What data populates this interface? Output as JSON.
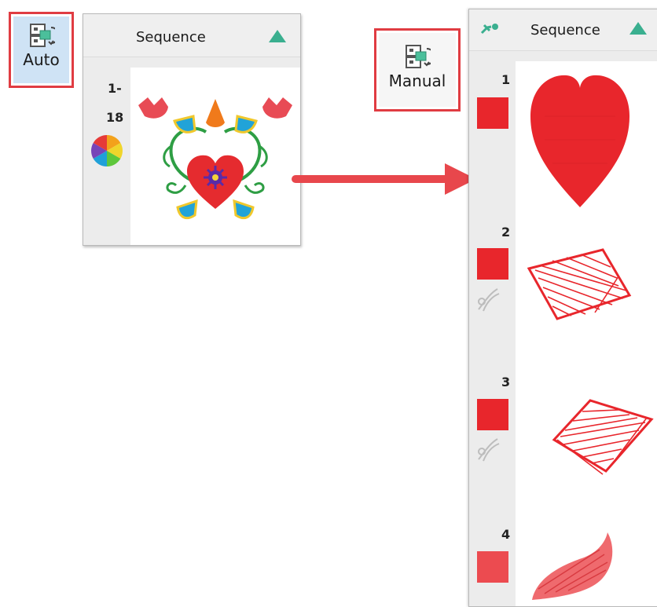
{
  "auto_button": {
    "label": "Auto",
    "icon": "auto-sequence-icon",
    "active": true
  },
  "manual_button": {
    "label": "Manual",
    "icon": "manual-sequence-icon"
  },
  "small_panel": {
    "title": "Sequence",
    "range_start": "1-",
    "range_end": "18",
    "icons": [
      "color-wheel-icon",
      "folk-heart-design-thumbnail"
    ]
  },
  "big_panel": {
    "title": "Sequence",
    "items": [
      {
        "number": "1",
        "color": "#e8262c",
        "thumbnail": "heart-fill-object",
        "has_trim": false
      },
      {
        "number": "2",
        "color": "#e8262c",
        "thumbnail": "diamond-stitch-object",
        "has_trim": true
      },
      {
        "number": "3",
        "color": "#e8262c",
        "thumbnail": "diamond-stitch-object",
        "has_trim": true
      },
      {
        "number": "4",
        "color": "#ec4b50",
        "thumbnail": "leaf-stitch-object",
        "has_trim": false
      }
    ]
  },
  "colors": {
    "highlight": "#e03c42",
    "accent": "#3aaf8f",
    "arrow": "#e8474c",
    "active_bg": "#cfe3f5"
  }
}
